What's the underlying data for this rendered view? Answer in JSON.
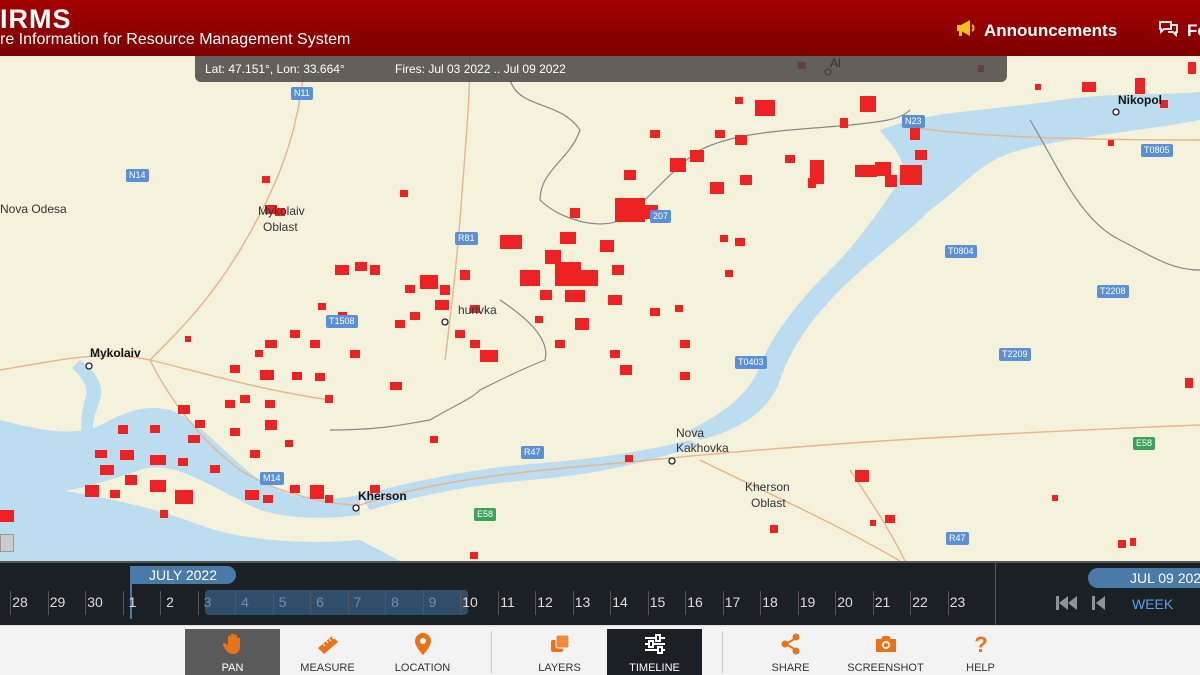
{
  "header": {
    "brand": "IRMS",
    "subtitle": "re Information for Resource Management System",
    "announcements": "Announcements",
    "feedback": "Fe",
    "announce_icon": "megaphone-icon",
    "feedback_icon": "chat-icon"
  },
  "infobar": {
    "latlon": "Lat: 47.151°, Lon: 33.664°",
    "fires": "Fires: Jul 03 2022 .. Jul 09 2022"
  },
  "map": {
    "places": [
      {
        "id": "nova-odesa",
        "text": "Nova Odesa"
      },
      {
        "id": "mykolaiv-oblast-1",
        "text": "Mykolaiv"
      },
      {
        "id": "mykolaiv-oblast-2",
        "text": "Oblast"
      },
      {
        "id": "mykolaiv",
        "text": "Mykolaiv"
      },
      {
        "id": "snihurivka",
        "text": "hurivka"
      },
      {
        "id": "kherson",
        "text": "Kherson"
      },
      {
        "id": "nova-kakhovka-1",
        "text": "Nova"
      },
      {
        "id": "nova-kakhovka-2",
        "text": "Kakhovka"
      },
      {
        "id": "kherson-oblast-1",
        "text": "Kherson"
      },
      {
        "id": "kherson-oblast-2",
        "text": "Oblast"
      },
      {
        "id": "nikopol",
        "text": "Nikopol"
      },
      {
        "id": "top-al",
        "text": "Al"
      }
    ],
    "roads": [
      "N11",
      "N14",
      "R81",
      "T1508",
      "M14",
      "R47",
      "E58",
      "N23",
      "T0805",
      "T0804",
      "T2208",
      "T2209",
      "T0403",
      "E58",
      "R47",
      "207"
    ]
  },
  "timeline": {
    "month": "JULY 2022",
    "days": [
      "28",
      "29",
      "30",
      "1",
      "2",
      "3",
      "4",
      "5",
      "6",
      "7",
      "8",
      "9",
      "10",
      "11",
      "12",
      "13",
      "14",
      "15",
      "16",
      "17",
      "18",
      "19",
      "20",
      "21",
      "22",
      "23"
    ],
    "selected_date": "JUL 09 202",
    "period": "WEEK"
  },
  "toolbar": {
    "pan": "PAN",
    "measure": "MEASURE",
    "location": "LOCATION",
    "layers": "LAYERS",
    "timeline": "TIMELINE",
    "share": "SHARE",
    "screenshot": "SCREENSHOT",
    "help": "HELP"
  },
  "colors": {
    "header": "#9a0000",
    "fire": "#ee2222",
    "water": "#bcdcef",
    "land": "#f5f2dc",
    "accent": "#4a7aa8",
    "icon_orange": "#e8741a"
  }
}
